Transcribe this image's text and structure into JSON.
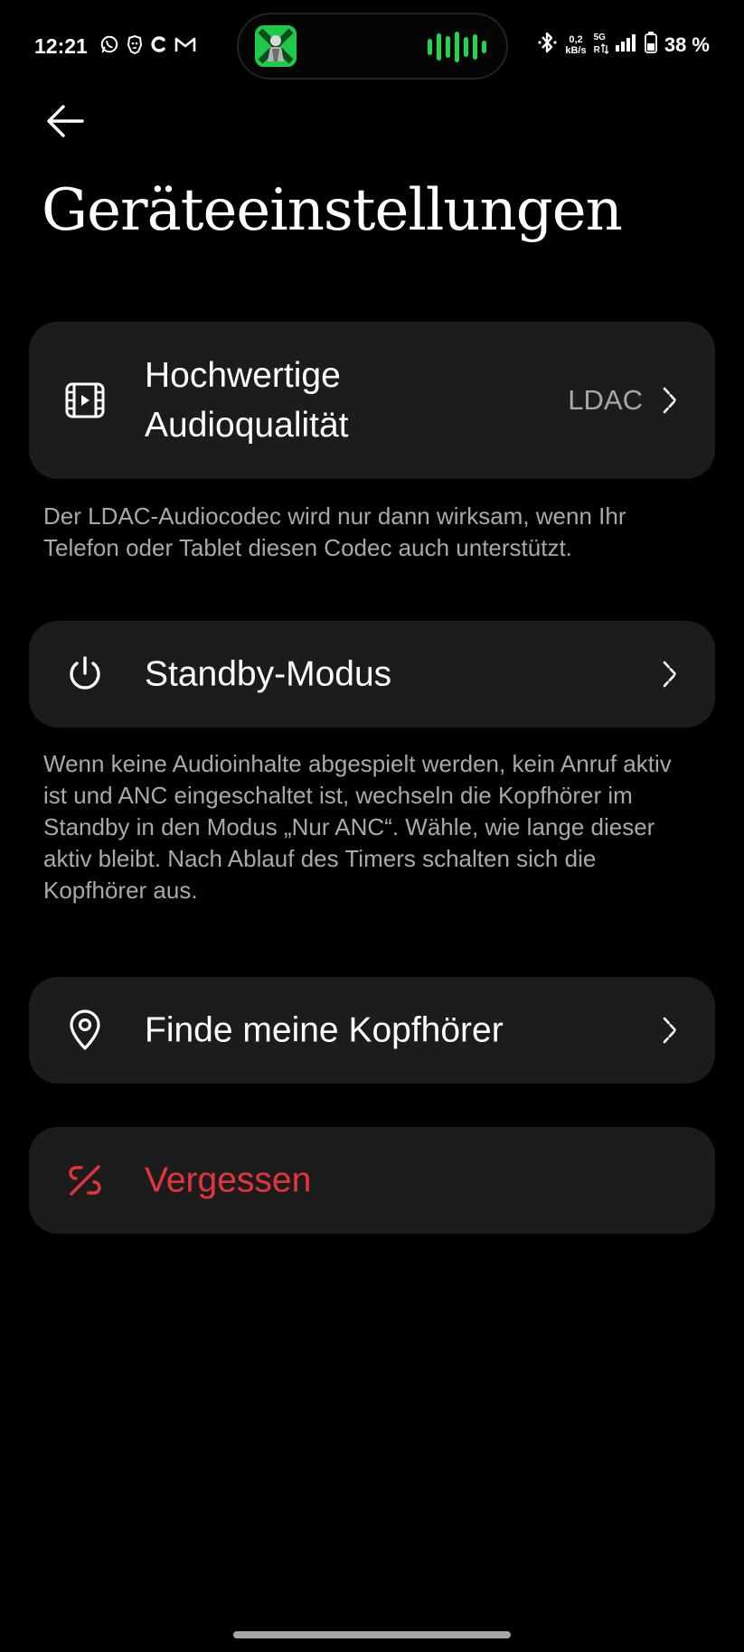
{
  "status_bar": {
    "time": "12:21",
    "notification_icons": [
      "whatsapp-icon",
      "lion-app-icon",
      "c-app-icon",
      "gmail-icon"
    ],
    "media_island": {
      "cover_icon": "album-cover-icon",
      "playing_indicator": "audio-wave-icon",
      "accent_color": "#22d64c"
    },
    "net_speed_value": "0,2",
    "net_speed_unit": "kB/s",
    "network_type": "5G",
    "roaming_label": "R",
    "battery_percent": "38 %"
  },
  "header": {
    "back_icon": "arrow-left-icon",
    "title": "Geräteeinstellungen"
  },
  "settings": {
    "audio_quality": {
      "icon": "film-icon",
      "label": "Hochwertige Audioqualität",
      "value": "LDAC",
      "description": "Der LDAC-Audiocodec wird nur dann wirksam, wenn Ihr Telefon oder Tablet diesen Codec auch unterstützt."
    },
    "standby": {
      "icon": "power-icon",
      "label": "Standby-Modus",
      "description": "Wenn keine Audioinhalte abgespielt werden, kein Anruf aktiv ist und ANC eingeschaltet ist, wechseln die Kopfhörer im Standby in den Modus „Nur ANC“. Wähle, wie lange dieser aktiv bleibt. Nach Ablauf des Timers schalten sich die Kopfhörer aus."
    },
    "find": {
      "icon": "location-pin-icon",
      "label": "Finde meine Kopfhörer"
    },
    "forget": {
      "icon": "unlink-icon",
      "label": "Vergessen",
      "color": "#e5343c"
    }
  },
  "colors": {
    "background": "#000000",
    "card": "#1c1c1c",
    "secondary_text": "#a9a9a9",
    "danger": "#e5343c"
  }
}
